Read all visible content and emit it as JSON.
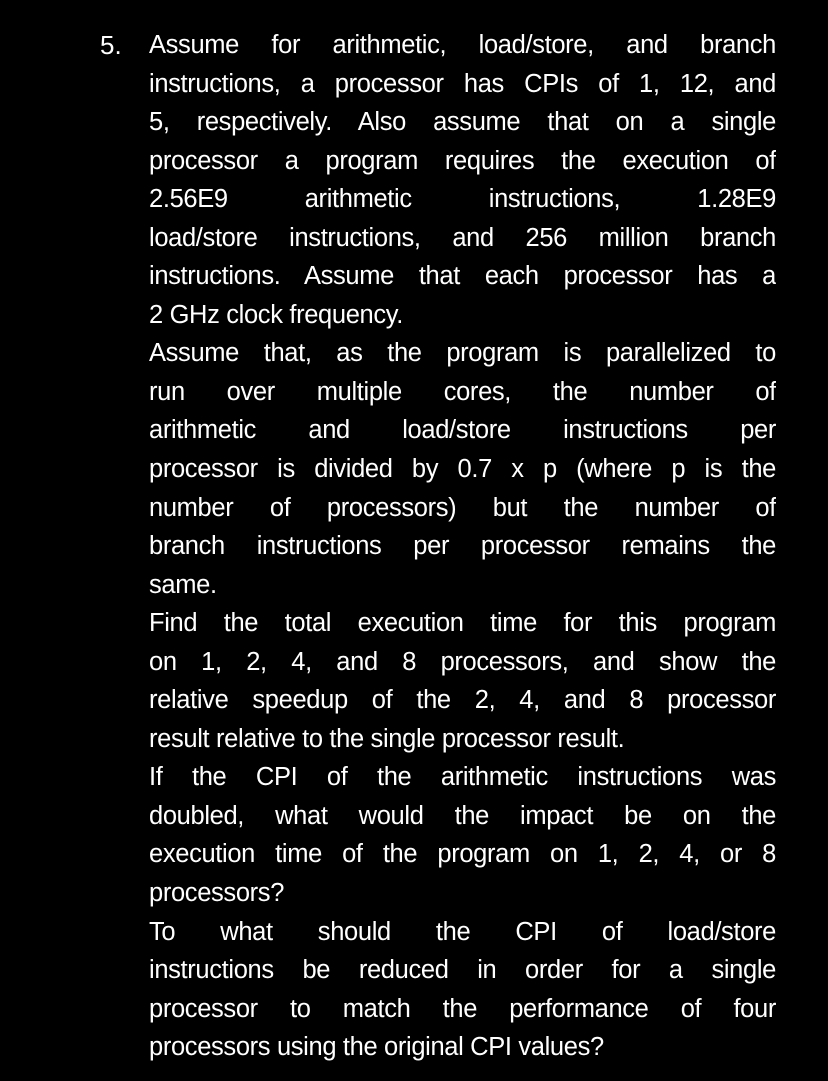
{
  "document": {
    "background_color": "#000000",
    "text_color": "#ffffff",
    "question": {
      "number": "5.",
      "paragraphs": [
        {
          "id": "setup",
          "lines": [
            {
              "text": "Assume for arithmetic, load/store, and branch",
              "justify": true
            },
            {
              "text": "instructions, a processor has CPIs of 1, 12, and",
              "justify": true
            },
            {
              "text": "5, respectively. Also assume that on a single",
              "justify": true
            },
            {
              "text": "processor a program requires the execution of",
              "justify": true
            },
            {
              "text": "2.56E9 arithmetic instructions, 1.28E9",
              "justify": true
            },
            {
              "text": "load/store instructions, and 256 million branch",
              "justify": true
            },
            {
              "text": "instructions. Assume that each processor has a",
              "justify": true
            },
            {
              "text": "2 GHz clock frequency.",
              "justify": false
            }
          ]
        },
        {
          "id": "parallel-assumption",
          "lines": [
            {
              "text": "Assume that, as the program is parallelized to",
              "justify": true
            },
            {
              "text": "run over multiple cores, the number of",
              "justify": true
            },
            {
              "text": "arithmetic and load/store instructions per",
              "justify": true
            },
            {
              "text": "processor is divided by 0.7 x p (where p is the",
              "justify": true
            },
            {
              "text": "number of processors) but the number of",
              "justify": true
            },
            {
              "text": "branch instructions per processor remains the",
              "justify": true
            },
            {
              "text": "same.",
              "justify": false
            }
          ]
        },
        {
          "id": "part-a",
          "lines": [
            {
              "text": "Find the total execution time for this program",
              "justify": true
            },
            {
              "text": "on 1, 2, 4, and 8 processors, and show the",
              "justify": true
            },
            {
              "text": "relative speedup of the 2, 4, and 8 processor",
              "justify": true
            },
            {
              "text": "result relative to the single processor result.",
              "justify": false
            }
          ]
        },
        {
          "id": "part-b",
          "lines": [
            {
              "text": "If the CPI of the arithmetic instructions was",
              "justify": true
            },
            {
              "text": "doubled, what would the impact be on the",
              "justify": true
            },
            {
              "text": "execution time of the program on 1, 2, 4, or 8",
              "justify": true
            },
            {
              "text": "processors?",
              "justify": false
            }
          ]
        },
        {
          "id": "part-c",
          "lines": [
            {
              "text": "To what should the CPI of load/store",
              "justify": true
            },
            {
              "text": "instructions be reduced in order for a single",
              "justify": true
            },
            {
              "text": "processor to match the performance of four",
              "justify": true
            },
            {
              "text": "processors using the original CPI values?",
              "justify": false
            }
          ]
        }
      ]
    }
  }
}
